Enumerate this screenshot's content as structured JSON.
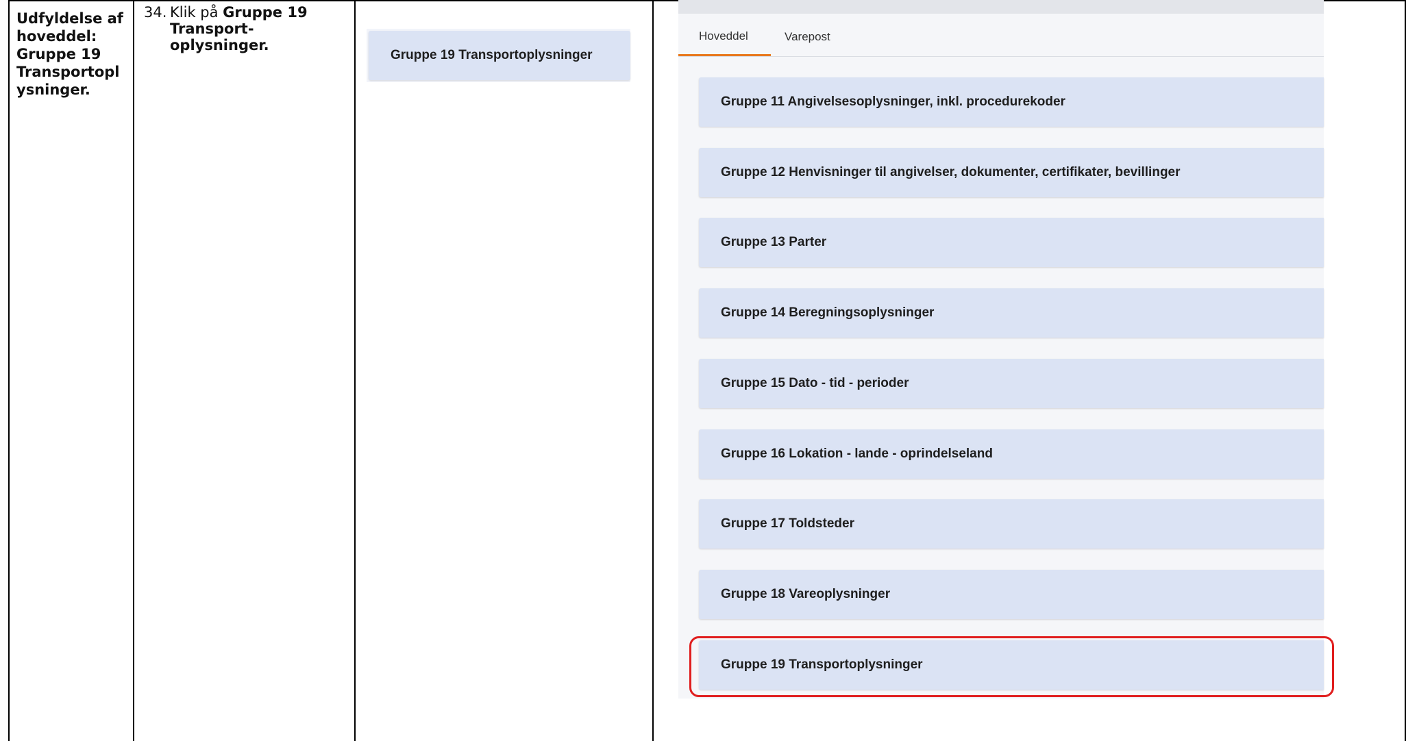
{
  "row": {
    "title": "Udfyldelse af hoveddel: Gruppe 19 Transportoplysninger.",
    "title_lines": [
      "Udfyldelse af",
      "hoveddel:",
      "Gruppe 19",
      "Transportopl",
      "ysninger."
    ],
    "step": {
      "number": "34.",
      "prefix": "Klik på",
      "bold_lines": [
        "Gruppe 19",
        "Transport-",
        "oplysninger."
      ]
    },
    "cropped_button_label": "Gruppe 19 Transportoplysninger"
  },
  "screenshot": {
    "tabs": [
      {
        "label": "Hoveddel",
        "active": true
      },
      {
        "label": "Varepost",
        "active": false
      }
    ],
    "groups": [
      "Gruppe 11 Angivelsesoplysninger, inkl. procedurekoder",
      "Gruppe 12 Henvisninger til angivelser, dokumenter, certifikater, bevillinger",
      "Gruppe 13 Parter",
      "Gruppe 14 Beregningsoplysninger",
      "Gruppe 15 Dato - tid - perioder",
      "Gruppe 16 Lokation - lande - oprindelseland",
      "Gruppe 17 Toldsteder",
      "Gruppe 18 Vareoplysninger",
      "Gruppe 19 Transportoplysninger"
    ],
    "highlighted_group": "Gruppe 19 Transportoplysninger"
  },
  "colors": {
    "button_bg": "#dbe3f4",
    "active_tab_underline": "#e8791e",
    "highlight": "#e01e1e"
  }
}
